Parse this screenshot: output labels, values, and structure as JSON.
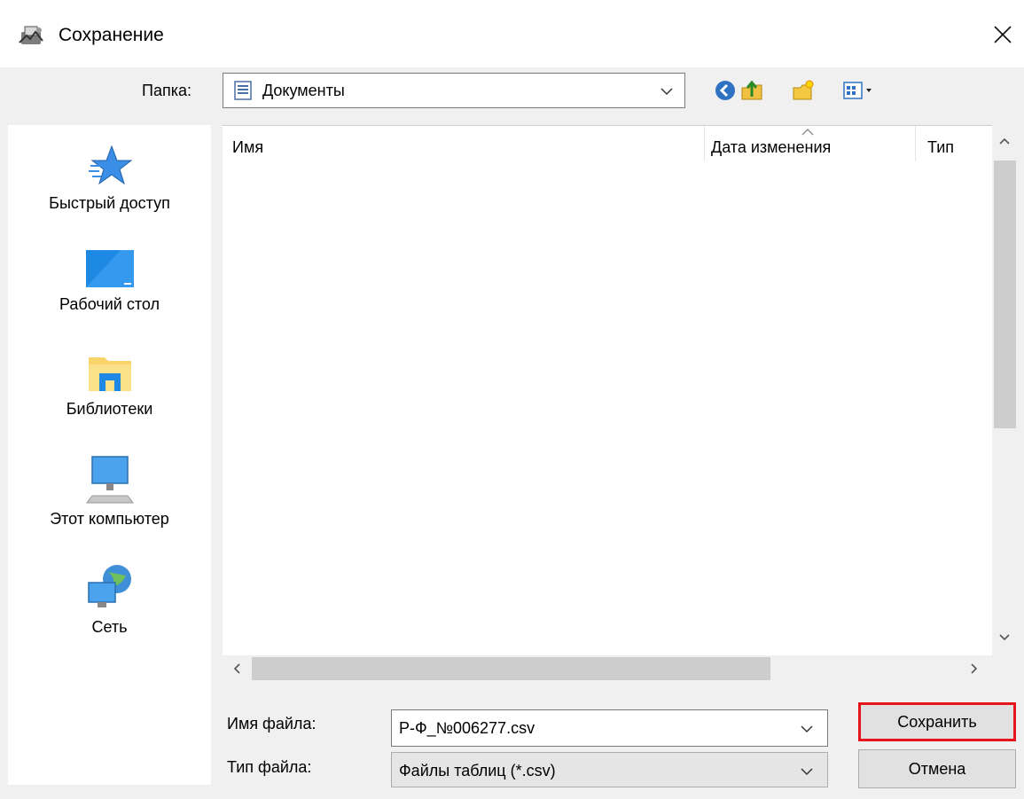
{
  "window": {
    "title": "Сохранение",
    "icon": "save-app-icon",
    "close_label": "×"
  },
  "toolbar": {
    "folder_label": "Папка:",
    "folder_value": "Документы",
    "icons": [
      "back-icon",
      "up-folder-icon",
      "new-folder-icon",
      "view-menu-icon"
    ]
  },
  "places": [
    {
      "label": "Быстрый доступ",
      "icon": "quick-access-star-icon"
    },
    {
      "label": "Рабочий стол",
      "icon": "desktop-icon"
    },
    {
      "label": "Библиотеки",
      "icon": "libraries-icon"
    },
    {
      "label": "Этот компьютер",
      "icon": "computer-icon"
    },
    {
      "label": "Сеть",
      "icon": "network-icon"
    }
  ],
  "file_list": {
    "columns": [
      "Имя",
      "Дата изменения",
      "Тип"
    ],
    "rows": []
  },
  "form": {
    "filename_label": "Имя файла:",
    "filename_value": "Р-Ф_№006277.csv",
    "filetype_label": "Тип файла:",
    "filetype_value": "Файлы таблиц (*.csv)"
  },
  "buttons": {
    "save": "Сохранить",
    "cancel": "Отмена"
  },
  "colors": {
    "highlight": "#e8141b",
    "dialog_bg": "#f0f0f0"
  }
}
